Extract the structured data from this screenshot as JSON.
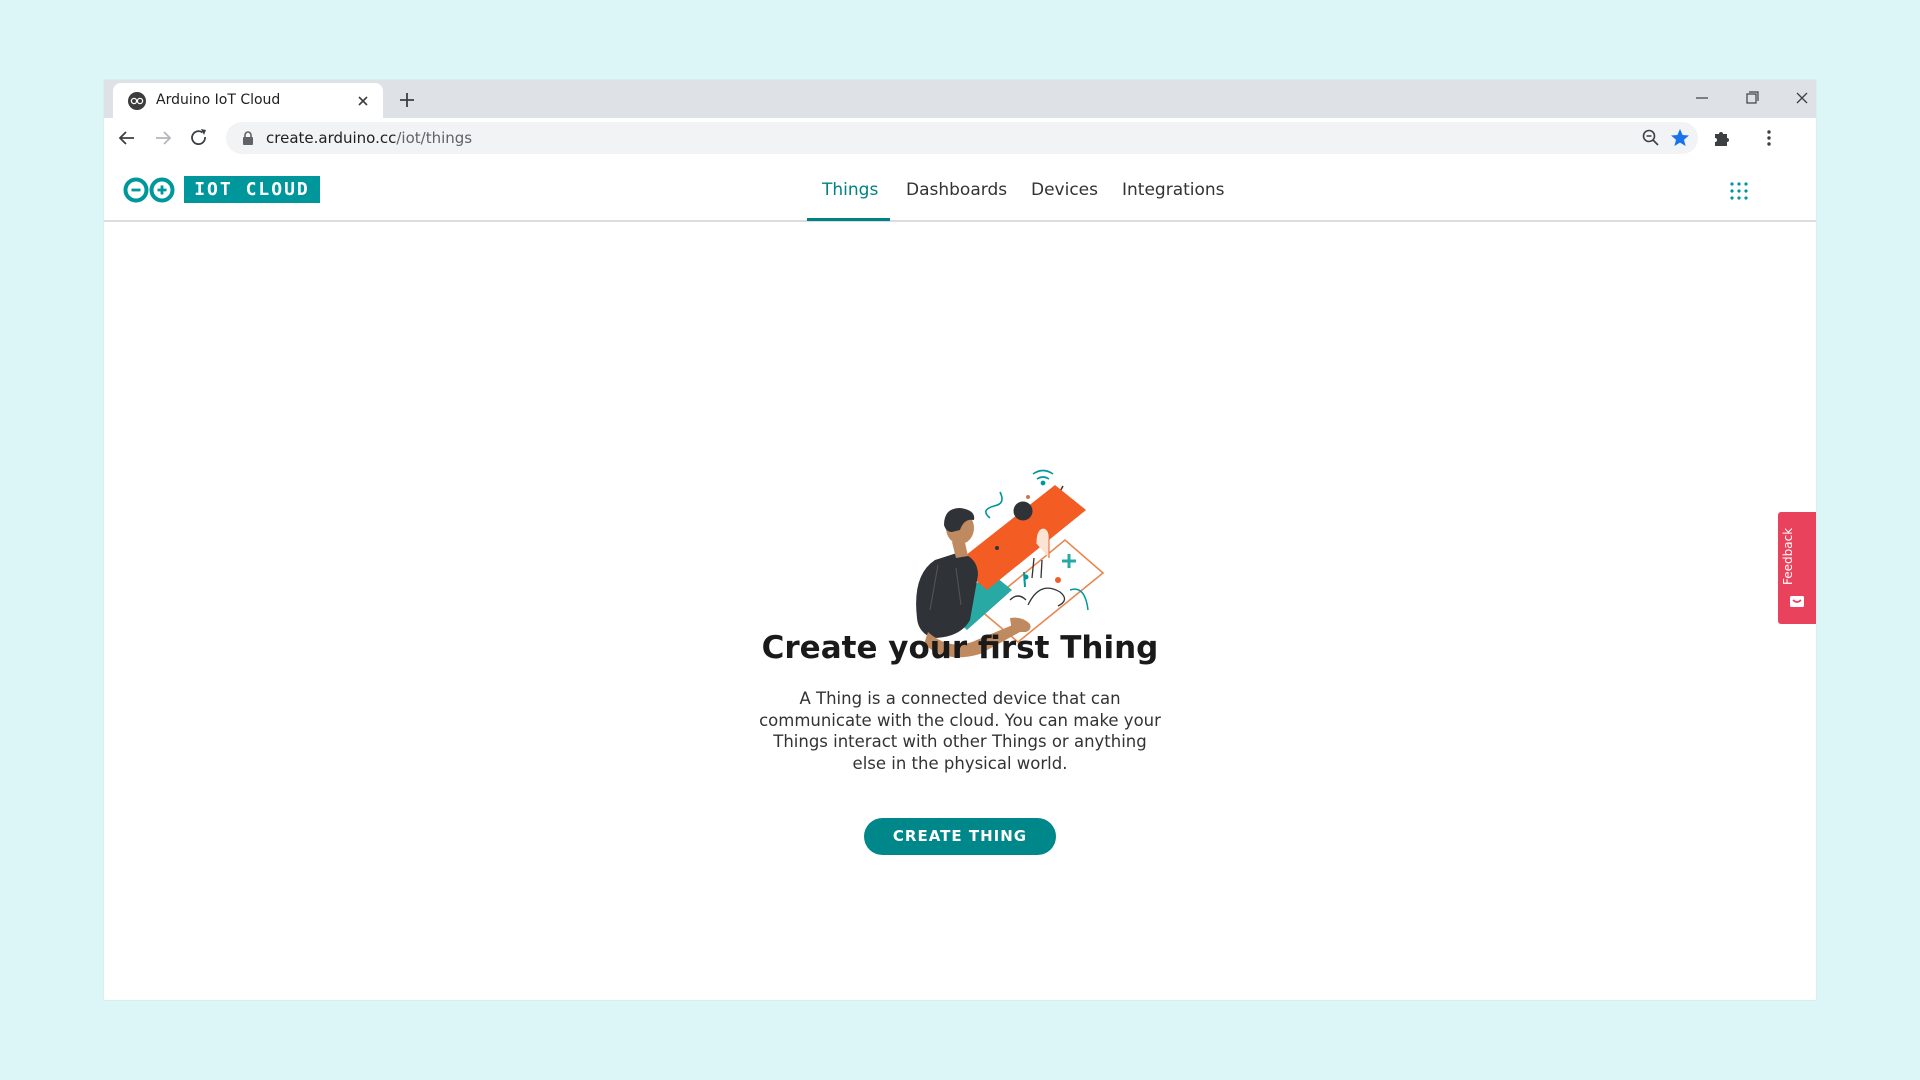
{
  "browser": {
    "tab_title": "Arduino IoT Cloud",
    "url_host": "create.arduino.cc",
    "url_path": "/iot/things"
  },
  "app": {
    "logo_text": "IOT CLOUD",
    "brand_color": "#00979c",
    "nav": [
      {
        "label": "Things",
        "active": true
      },
      {
        "label": "Dashboards",
        "active": false
      },
      {
        "label": "Devices",
        "active": false
      },
      {
        "label": "Integrations",
        "active": false
      }
    ]
  },
  "empty_state": {
    "title": "Create your first Thing",
    "description": "A Thing is a connected device that can communicate with the cloud. You can make your Things interact with other Things or anything else in the physical world.",
    "button_label": "CREATE THING",
    "button_color": "#00878a"
  },
  "feedback": {
    "label": "Feedback",
    "color": "#e9425d"
  }
}
